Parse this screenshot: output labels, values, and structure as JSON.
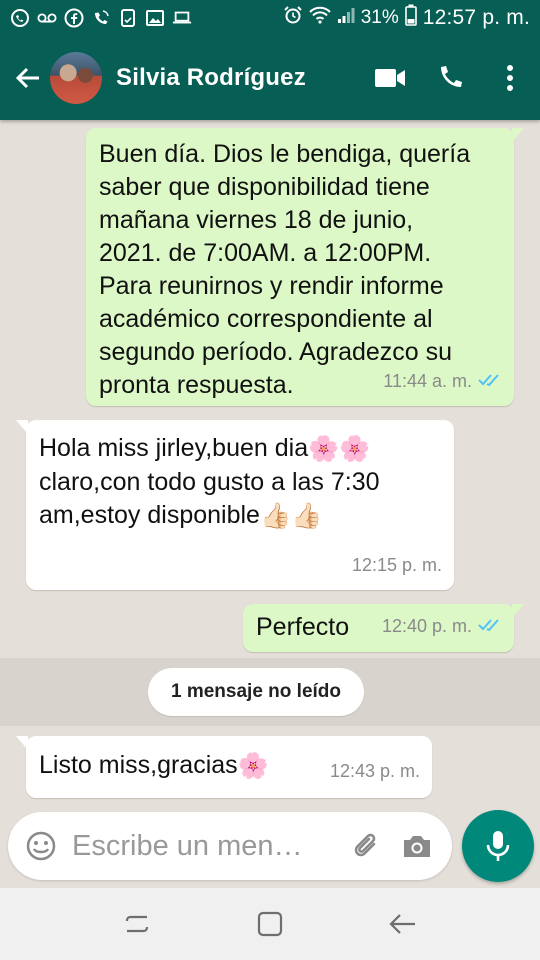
{
  "status_bar": {
    "battery": "31%",
    "time": "12:57 p. m."
  },
  "header": {
    "contact_name": "Silvia Rodríguez",
    "icons": [
      "back-arrow-icon",
      "video-call-icon",
      "phone-icon",
      "more-vert-icon"
    ]
  },
  "messages": [
    {
      "direction": "outgoing",
      "text": "Buen día. Dios le bendiga, quería saber que disponibilidad tiene mañana viernes 18 de junio, 2021. de 7:00AM. a 12:00PM. Para reunirnos y rendir informe académico correspondiente al segundo período. Agradezco su pronta respuesta.",
      "lines": [
        "Buen día. Dios le bendiga, quería",
        "saber que disponibilidad tiene",
        "mañana viernes 18 de junio,",
        "2021. de 7:00AM. a 12:00PM.",
        "Para reunirnos y rendir informe",
        "académico correspondiente al",
        "segundo período. Agradezco su",
        "pronta respuesta."
      ],
      "time": "11:44 a. m.",
      "status": "read"
    },
    {
      "direction": "incoming",
      "lines": [
        "Hola miss jirley,buen dia",
        "claro,con todo gusto a las 7:30",
        "am,estoy disponible"
      ],
      "emoji": [
        "🌸🌸",
        "",
        "👍🏻👍🏻"
      ],
      "time": "12:15 p. m."
    },
    {
      "direction": "outgoing",
      "text": "Perfecto",
      "time": "12:40 p. m.",
      "status": "read"
    },
    {
      "direction": "incoming",
      "text": "Listo miss,gracias",
      "emoji": "🌸",
      "time": "12:43 p. m."
    }
  ],
  "unread_divider": "1 mensaje no leído",
  "composer": {
    "placeholder": "Escribe un men…"
  },
  "colors": {
    "header": "#075e54",
    "outgoing_bubble": "#dcf8c6",
    "incoming_bubble": "#ffffff",
    "chat_background": "#e4dfd8",
    "mic_button": "#00897b",
    "read_ticks": "#4fc3f7"
  }
}
